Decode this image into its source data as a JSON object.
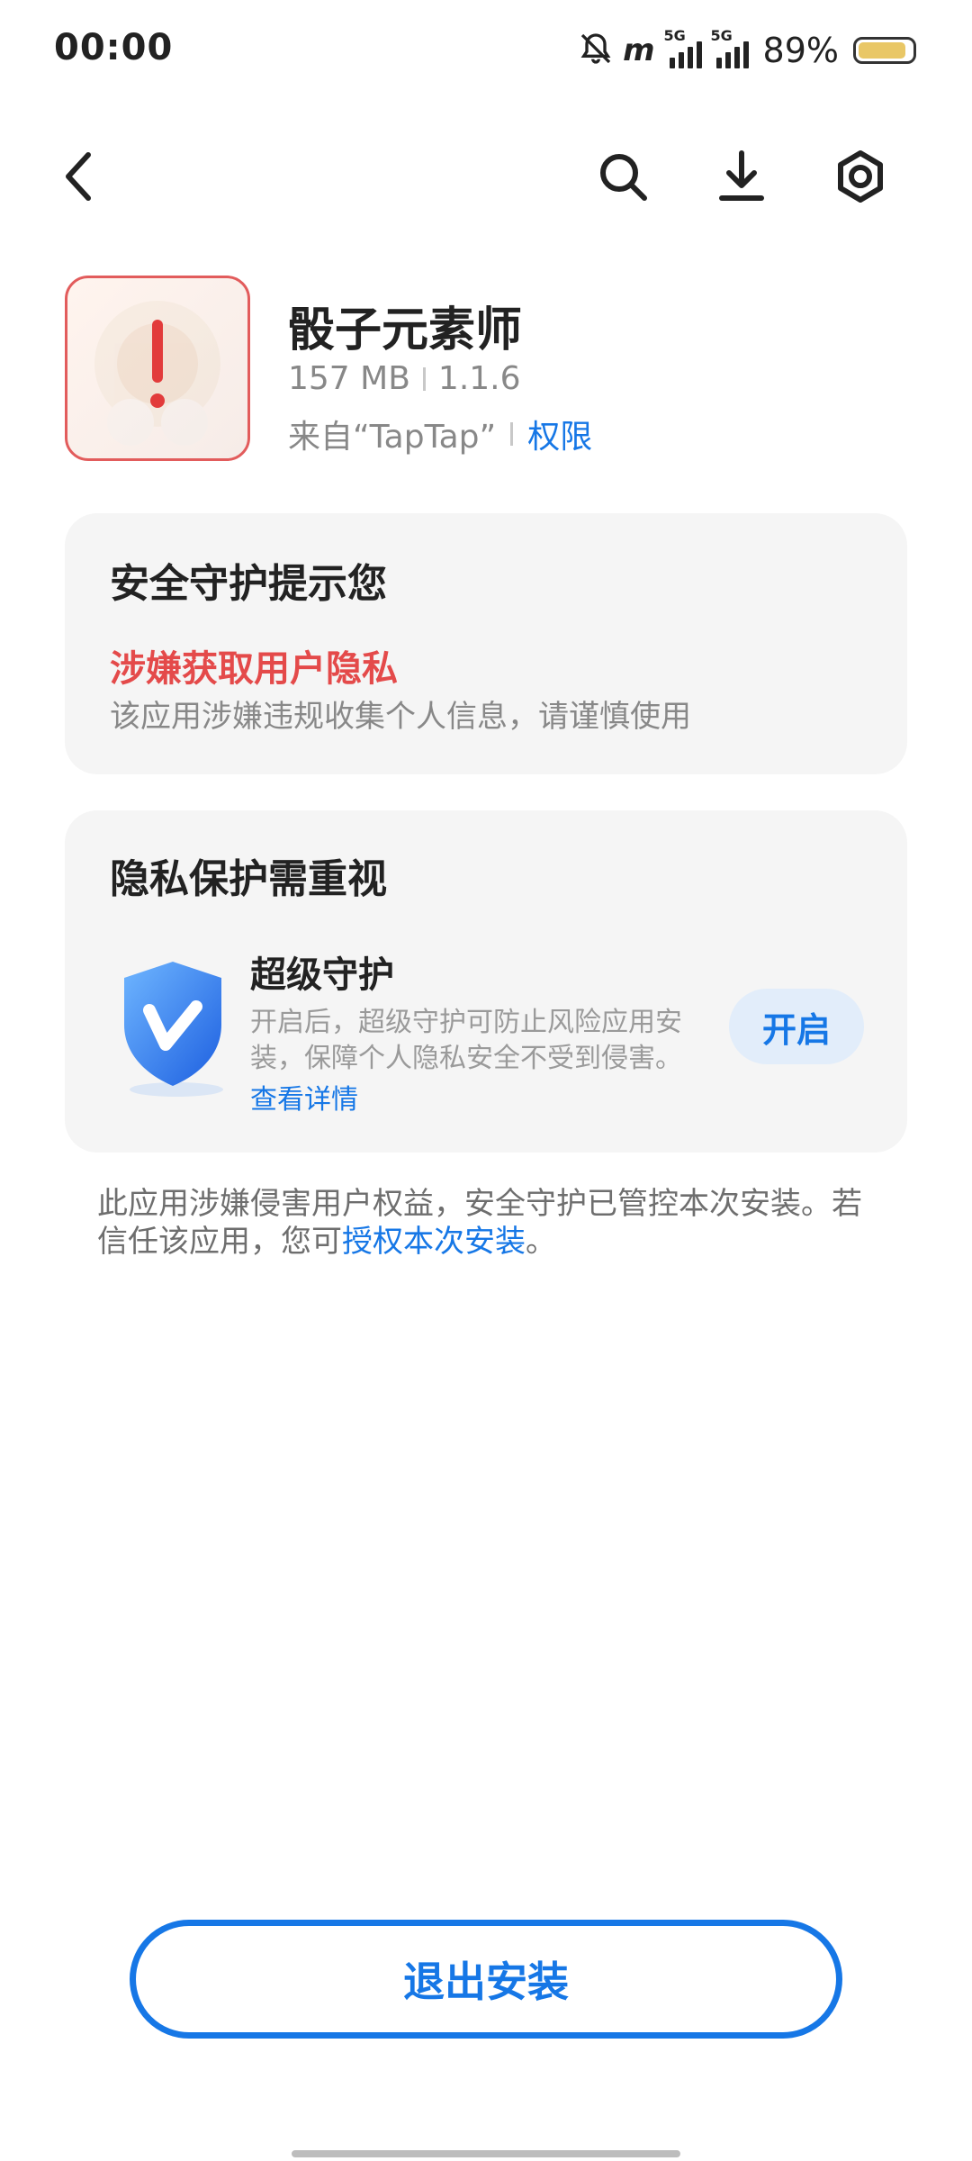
{
  "status_bar": {
    "time": "00:00",
    "network_label": "5G",
    "battery_percent": "89%",
    "battery_level": 0.89
  },
  "nav": {
    "back_icon": "chevron-left-icon",
    "search_icon": "search-icon",
    "download_icon": "download-icon",
    "settings_icon": "gear-icon"
  },
  "app": {
    "name": "骰子元素师",
    "size": "157 MB",
    "version": "1.1.6",
    "source": "来自“TapTap”",
    "permissions_link": "权限"
  },
  "security_card": {
    "title": "安全守护提示您",
    "warning_title": "涉嫌获取用户隐私",
    "warning_desc": "该应用涉嫌违规收集个人信息，请谨慎使用"
  },
  "privacy_card": {
    "title": "隐私保护需重视",
    "feature_title": "超级守护",
    "feature_desc": "开启后，超级守护可防止风险应用安装，保障个人隐私安全不受到侵害。",
    "details_link": "查看详情",
    "open_button": "开启"
  },
  "bottom_note": {
    "text": "此应用涉嫌侵害用户权益，安全守护已管控本次安装。若信任该应用，您可",
    "link": "授权本次安装",
    "suffix": "。"
  },
  "exit_button": "退出安装",
  "colors": {
    "accent": "#1677e6",
    "danger": "#e44a4a",
    "card_bg": "#f5f5f5"
  }
}
